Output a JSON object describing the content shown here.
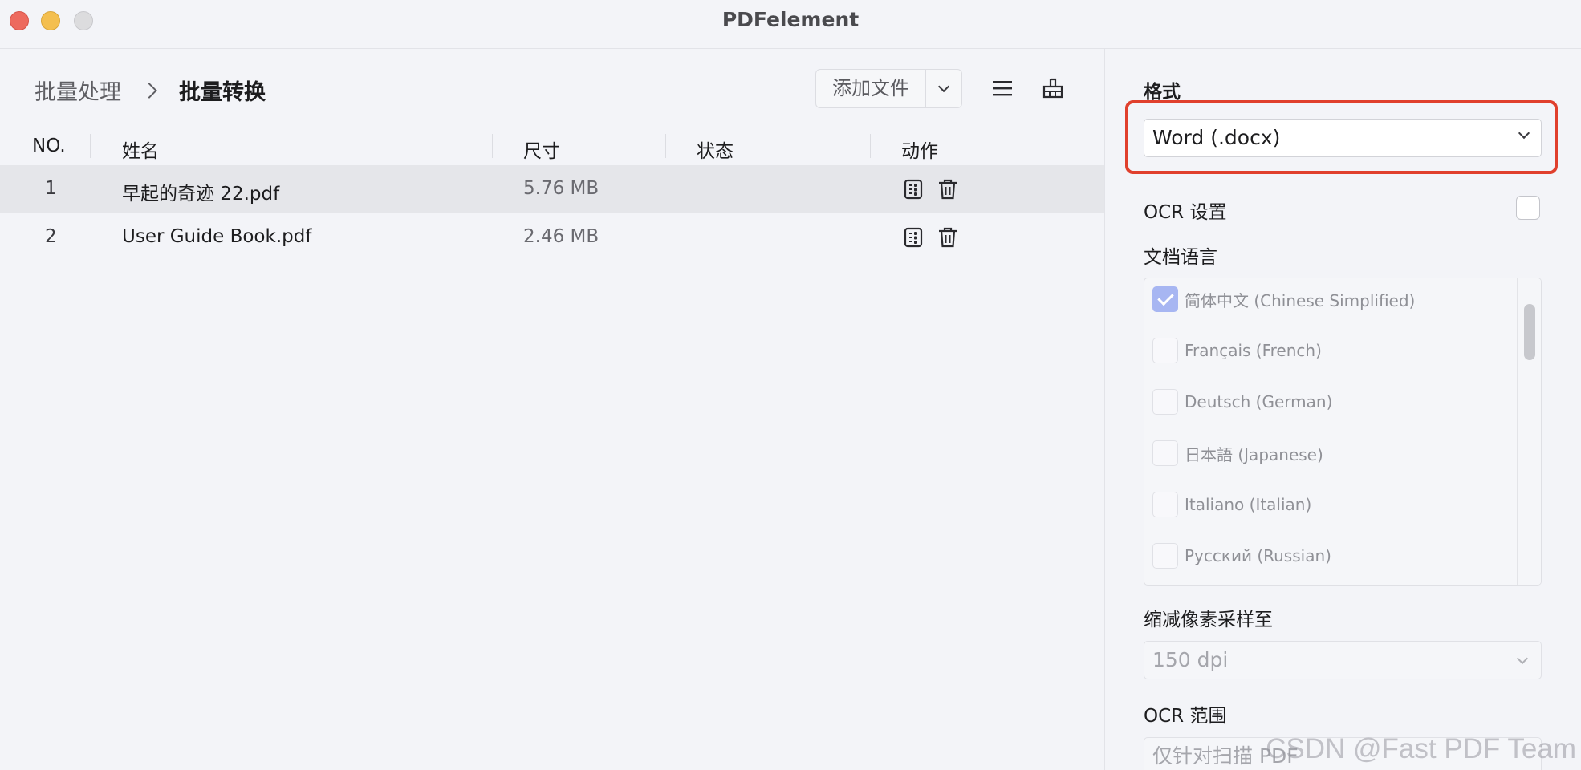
{
  "window": {
    "title": "PDFelement"
  },
  "breadcrumb": {
    "parent": "批量处理",
    "current": "批量转换"
  },
  "toolbar": {
    "add_files_label": "添加文件"
  },
  "table": {
    "headers": {
      "no": "NO.",
      "name": "姓名",
      "size": "尺寸",
      "status": "状态",
      "action": "动作"
    },
    "rows": [
      {
        "no": "1",
        "name": "早起的奇迹 22.pdf",
        "size": "5.76 MB",
        "status": "",
        "selected": true
      },
      {
        "no": "2",
        "name": "User Guide Book.pdf",
        "size": "2.46 MB",
        "status": "",
        "selected": false
      }
    ]
  },
  "settings": {
    "format_label": "格式",
    "format_value": "Word (.docx)",
    "ocr_label": "OCR 设置",
    "ocr_checked": false,
    "doc_language_label": "文档语言",
    "languages": [
      {
        "label": "简体中文 (Chinese Simplified)",
        "checked": true
      },
      {
        "label": "Français (French)",
        "checked": false
      },
      {
        "label": "Deutsch (German)",
        "checked": false
      },
      {
        "label": "日本語 (Japanese)",
        "checked": false
      },
      {
        "label": "Italiano (Italian)",
        "checked": false
      },
      {
        "label": "Русский (Russian)",
        "checked": false
      }
    ],
    "downsample_label": "缩减像素采样至",
    "downsample_value": "150 dpi",
    "ocr_range_label": "OCR 范围",
    "ocr_range_value": "仅针对扫描 PDF"
  },
  "watermark": "CSDN @Fast PDF Team",
  "colors": {
    "highlight": "#e0402d",
    "selected_row": "#e5e6ea",
    "checked": "#a7b6f2"
  }
}
